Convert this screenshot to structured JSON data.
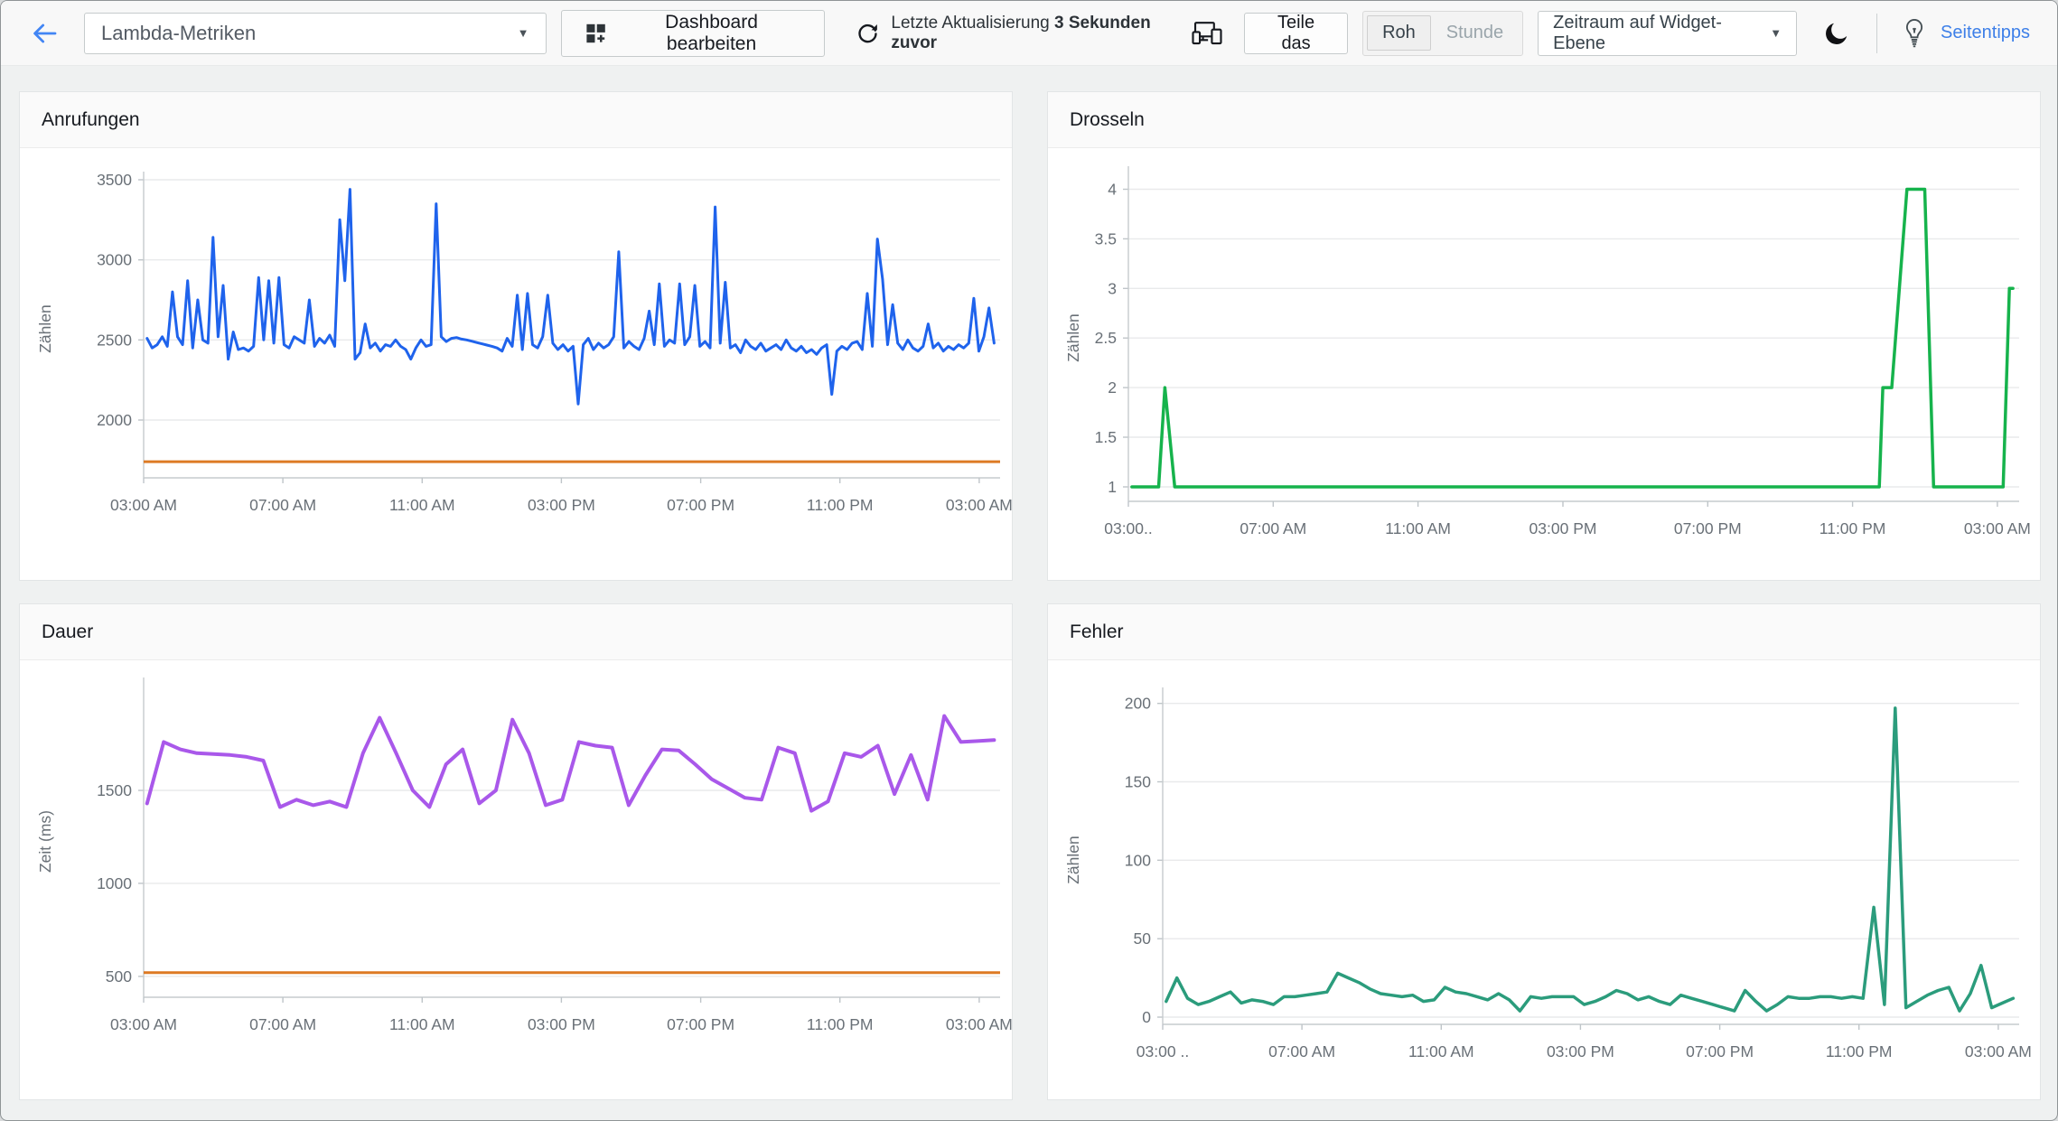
{
  "header": {
    "back_label": "back",
    "dashboard_select": {
      "value": "Lambda-Metriken"
    },
    "edit_button": "Dashboard bearbeiten",
    "refresh": {
      "label": "Letzte Aktualisierung",
      "ago": "3 Sekunden zuvor"
    },
    "share_button": "Teile das",
    "granularity_toggle": {
      "options": [
        "Roh",
        "Stunde"
      ],
      "selected": "Roh"
    },
    "period_select": "Zeitraum auf Widget-Ebene",
    "tips_link": "Seitentipps",
    "colors": {
      "link_blue": "#3d7fe8",
      "back_blue": "#4285f4"
    }
  },
  "charts": [
    {
      "type": "line",
      "title": "Anrufungen",
      "ylabel": "Zählen",
      "ylim": [
        1639,
        3500
      ],
      "yticks": [
        2000,
        2500,
        3000,
        3500
      ],
      "xlabels": [
        "03:00 AM",
        "07:00 AM",
        "11:00 AM",
        "03:00 PM",
        "07:00 PM",
        "11:00 PM",
        "03:00 AM"
      ],
      "xlabel_fracs": [
        0,
        0.1626,
        0.3252,
        0.4878,
        0.6504,
        0.813,
        0.9756
      ],
      "grid": true,
      "legend": "none",
      "hline": {
        "value": 1740,
        "color": "#dd7a24"
      },
      "series": [
        {
          "name": "Anrufungen",
          "color": "#1f63ec",
          "width": 3,
          "values": [
            2510,
            2450,
            2470,
            2520,
            2460,
            2800,
            2520,
            2470,
            2870,
            2450,
            2750,
            2500,
            2480,
            3140,
            2520,
            2840,
            2380,
            2550,
            2440,
            2450,
            2430,
            2460,
            2890,
            2500,
            2870,
            2480,
            2890,
            2470,
            2450,
            2520,
            2500,
            2480,
            2750,
            2460,
            2510,
            2480,
            2530,
            2460,
            3250,
            2870,
            3440,
            2380,
            2420,
            2600,
            2450,
            2480,
            2430,
            2470,
            2460,
            2500,
            2460,
            2440,
            2380,
            2450,
            2500,
            2460,
            2470,
            3350,
            2520,
            2490,
            2510,
            2515,
            2505,
            2500,
            2492,
            2484,
            2476,
            2468,
            2460,
            2450,
            2430,
            2510,
            2460,
            2780,
            2440,
            2790,
            2470,
            2450,
            2520,
            2780,
            2480,
            2440,
            2470,
            2430,
            2460,
            2100,
            2470,
            2510,
            2440,
            2480,
            2450,
            2470,
            2520,
            3050,
            2450,
            2490,
            2460,
            2440,
            2510,
            2680,
            2470,
            2850,
            2460,
            2500,
            2480,
            2850,
            2470,
            2520,
            2840,
            2460,
            2490,
            2450,
            3330,
            2480,
            2860,
            2450,
            2470,
            2420,
            2500,
            2460,
            2440,
            2480,
            2430,
            2450,
            2470,
            2440,
            2500,
            2450,
            2430,
            2460,
            2420,
            2440,
            2410,
            2450,
            2470,
            2160,
            2430,
            2460,
            2440,
            2480,
            2490,
            2440,
            2790,
            2460,
            3130,
            2880,
            2470,
            2720,
            2480,
            2440,
            2500,
            2450,
            2430,
            2460,
            2600,
            2450,
            2480,
            2430,
            2460,
            2440,
            2470,
            2450,
            2480,
            2760,
            2430,
            2520,
            2700,
            2480
          ]
        }
      ]
    },
    {
      "type": "line",
      "title": "Drosseln",
      "ylabel": "Zählen",
      "ylim": [
        0.854,
        4.15
      ],
      "yticks": [
        1,
        1.5,
        2,
        2.5,
        3,
        3.5,
        4
      ],
      "xlabels": [
        "03:00..",
        "07:00 AM",
        "11:00 AM",
        "03:00 PM",
        "07:00 PM",
        "11:00 PM",
        "03:00 AM"
      ],
      "xlabel_fracs": [
        0,
        0.1626,
        0.3252,
        0.4878,
        0.6504,
        0.813,
        0.9756
      ],
      "grid": true,
      "legend": "none",
      "series": [
        {
          "name": "Drosseln",
          "color": "#16b34c",
          "width": 3.5,
          "points": [
            [
              0.004,
              1
            ],
            [
              0.02,
              1
            ],
            [
              0.034,
              1
            ],
            [
              0.041,
              2
            ],
            [
              0.052,
              1
            ],
            [
              0.2,
              1
            ],
            [
              0.4,
              1
            ],
            [
              0.6,
              1
            ],
            [
              0.8,
              1
            ],
            [
              0.843,
              1
            ],
            [
              0.847,
              2
            ],
            [
              0.857,
              2
            ],
            [
              0.874,
              4
            ],
            [
              0.894,
              4
            ],
            [
              0.904,
              1
            ],
            [
              0.95,
              1
            ],
            [
              0.982,
              1
            ],
            [
              0.989,
              3
            ],
            [
              0.993,
              3
            ]
          ]
        }
      ]
    },
    {
      "type": "line",
      "title": "Dauer",
      "ylabel": "Zeit (ms)",
      "ylim": [
        388,
        2063
      ],
      "yticks": [
        500,
        1000,
        1500
      ],
      "xlabels": [
        "03:00 AM",
        "07:00 AM",
        "11:00 AM",
        "03:00 PM",
        "07:00 PM",
        "11:00 PM",
        "03:00 AM"
      ],
      "xlabel_fracs": [
        0,
        0.1626,
        0.3252,
        0.4878,
        0.6504,
        0.813,
        0.9756
      ],
      "grid": true,
      "legend": "none",
      "hline": {
        "value": 520,
        "color": "#dd7a24"
      },
      "series": [
        {
          "name": "Dauer",
          "color": "#a958ea",
          "width": 4,
          "values": [
            1430,
            1760,
            1720,
            1700,
            1695,
            1690,
            1680,
            1660,
            1410,
            1450,
            1420,
            1440,
            1410,
            1700,
            1890,
            1700,
            1500,
            1410,
            1640,
            1720,
            1430,
            1500,
            1880,
            1700,
            1420,
            1450,
            1760,
            1740,
            1730,
            1420,
            1580,
            1720,
            1715,
            1640,
            1560,
            1510,
            1460,
            1450,
            1730,
            1700,
            1390,
            1440,
            1700,
            1680,
            1740,
            1480,
            1690,
            1450,
            1900,
            1760,
            1765,
            1770
          ]
        }
      ]
    },
    {
      "type": "line",
      "title": "Fehler",
      "ylabel": "Zählen",
      "ylim": [
        -4.6,
        205
      ],
      "yticks": [
        0,
        50,
        100,
        150,
        200
      ],
      "xlabels": [
        "03:00 ..",
        "07:00 AM",
        "11:00 AM",
        "03:00 PM",
        "07:00 PM",
        "11:00 PM",
        "03:00 AM"
      ],
      "xlabel_fracs": [
        0,
        0.1626,
        0.3252,
        0.4878,
        0.6504,
        0.813,
        0.9756
      ],
      "grid": true,
      "legend": "none",
      "series": [
        {
          "name": "Fehler",
          "color": "#2b9c7c",
          "width": 3.5,
          "values": [
            10,
            25,
            12,
            8,
            10,
            13,
            16,
            9,
            11,
            10,
            8,
            13,
            13,
            14,
            15,
            16,
            28,
            25,
            22,
            18,
            15,
            14,
            13,
            14,
            10,
            11,
            19,
            16,
            15,
            13,
            11,
            15,
            11,
            4,
            13,
            12,
            13,
            13,
            13,
            8,
            10,
            13,
            17,
            15,
            11,
            13,
            10,
            8,
            14,
            12,
            10,
            8,
            6,
            4,
            17,
            10,
            4,
            8,
            13,
            12,
            12,
            13,
            13,
            12,
            13,
            12,
            70,
            8,
            197,
            6,
            10,
            14,
            17,
            19,
            4,
            15,
            33,
            6,
            9,
            12
          ]
        }
      ]
    }
  ]
}
